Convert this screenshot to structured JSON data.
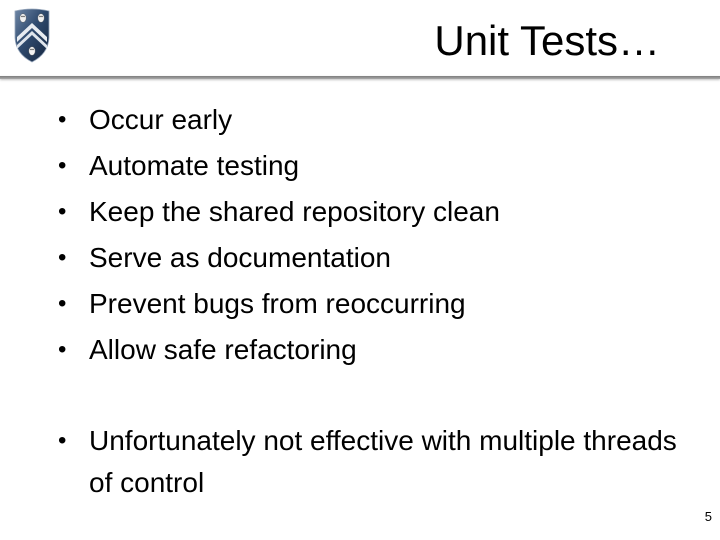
{
  "slide": {
    "title": "Unit Tests…",
    "logo": "rice-university-shield-logo",
    "bullets": [
      {
        "marker": "•",
        "text": "Occur early"
      },
      {
        "marker": "•",
        "text": "Automate testing"
      },
      {
        "marker": "•",
        "text": "Keep the shared repository clean"
      },
      {
        "marker": "•",
        "text": "Serve as documentation"
      },
      {
        "marker": "•",
        "text": "Prevent bugs from reoccurring"
      },
      {
        "marker": "•",
        "text": "Allow safe refactoring"
      }
    ],
    "bullets_secondary": [
      {
        "marker": "•",
        "text": "Unfortunately not effective with multiple threads of control"
      }
    ],
    "page_number": "5"
  },
  "colors": {
    "background": "#ffffff",
    "text": "#000000",
    "rule": "#8a8a8a",
    "shield": "#2a4466"
  }
}
